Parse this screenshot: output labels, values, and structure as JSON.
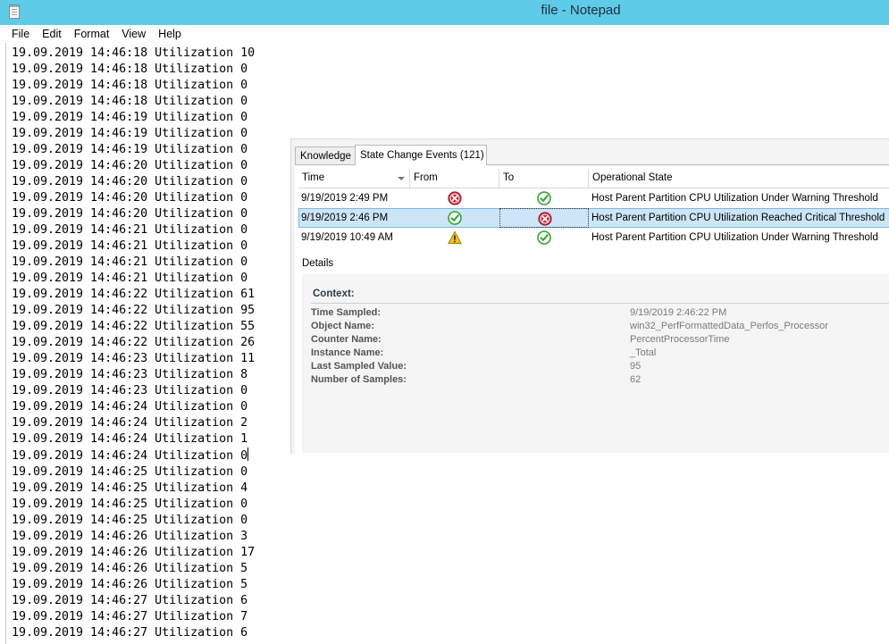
{
  "window": {
    "title": "file - Notepad"
  },
  "menu": [
    "File",
    "Edit",
    "Format",
    "View",
    "Help"
  ],
  "editor": {
    "lines": [
      "19.09.2019 14:46:18 Utilization 10",
      "19.09.2019 14:46:18 Utilization 0",
      "19.09.2019 14:46:18 Utilization 0",
      "19.09.2019 14:46:18 Utilization 0",
      "19.09.2019 14:46:19 Utilization 0",
      "19.09.2019 14:46:19 Utilization 0",
      "19.09.2019 14:46:19 Utilization 0",
      "19.09.2019 14:46:20 Utilization 0",
      "19.09.2019 14:46:20 Utilization 0",
      "19.09.2019 14:46:20 Utilization 0",
      "19.09.2019 14:46:20 Utilization 0",
      "19.09.2019 14:46:21 Utilization 0",
      "19.09.2019 14:46:21 Utilization 0",
      "19.09.2019 14:46:21 Utilization 0",
      "19.09.2019 14:46:21 Utilization 0",
      "19.09.2019 14:46:22 Utilization 61",
      "19.09.2019 14:46:22 Utilization 95",
      "19.09.2019 14:46:22 Utilization 55",
      "19.09.2019 14:46:22 Utilization 26",
      "19.09.2019 14:46:23 Utilization 11",
      "19.09.2019 14:46:23 Utilization 8",
      "19.09.2019 14:46:23 Utilization 0",
      "19.09.2019 14:46:24 Utilization 0",
      "19.09.2019 14:46:24 Utilization 2",
      "19.09.2019 14:46:24 Utilization 1",
      "19.09.2019 14:46:24 Utilization 0",
      "19.09.2019 14:46:25 Utilization 0",
      "19.09.2019 14:46:25 Utilization 4",
      "19.09.2019 14:46:25 Utilization 0",
      "19.09.2019 14:46:25 Utilization 0",
      "19.09.2019 14:46:26 Utilization 3",
      "19.09.2019 14:46:26 Utilization 17",
      "19.09.2019 14:46:26 Utilization 5",
      "19.09.2019 14:46:26 Utilization 5",
      "19.09.2019 14:46:27 Utilization 6",
      "19.09.2019 14:46:27 Utilization 7",
      "19.09.2019 14:46:27 Utilization 6"
    ],
    "caret_line_index": 25
  },
  "panel": {
    "tabs": [
      {
        "label": "Knowledge",
        "active": false
      },
      {
        "label": "State Change Events (121)",
        "active": true
      }
    ],
    "columns": {
      "time": "Time",
      "from": "From",
      "to": "To",
      "op": "Operational State"
    },
    "rows": [
      {
        "time": "9/19/2019 2:49 PM",
        "from": "critical",
        "to": "healthy",
        "state": "Host Parent Partition CPU Utilization Under Warning Threshold",
        "selected": false
      },
      {
        "time": "9/19/2019 2:46 PM",
        "from": "healthy",
        "to": "critical",
        "state": "Host Parent Partition CPU Utilization Reached Critical Threshold",
        "selected": true
      },
      {
        "time": "9/19/2019 10:49 AM",
        "from": "warning",
        "to": "healthy",
        "state": "Host Parent Partition CPU Utilization Under Warning Threshold",
        "selected": false
      }
    ],
    "details_label": "Details",
    "context_title": "Context:",
    "context": [
      {
        "label": "Time Sampled:",
        "value": "9/19/2019 2:46:22 PM"
      },
      {
        "label": "Object Name:",
        "value": "win32_PerfFormattedData_Perfos_Processor"
      },
      {
        "label": "Counter Name:",
        "value": "PercentProcessorTime"
      },
      {
        "label": "Instance Name:",
        "value": "_Total"
      },
      {
        "label": "Last Sampled Value:",
        "value": "95"
      },
      {
        "label": "Number of Samples:",
        "value": "62"
      }
    ]
  },
  "colors": {
    "titlebar": "#5ecbe8",
    "selection": "#cde6f7",
    "healthy": "#2fa32f",
    "critical": "#c8283c",
    "warning": "#f2c21a"
  }
}
